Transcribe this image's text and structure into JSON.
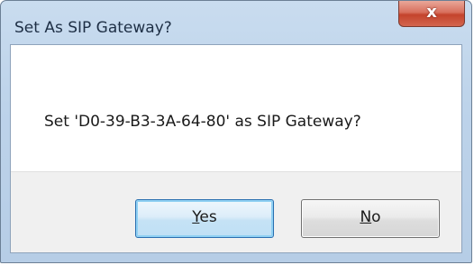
{
  "dialog": {
    "title": "Set As SIP Gateway?",
    "close_glyph": "x",
    "message": "Set 'D0-39-B3-3A-64-80' as SIP Gateway?",
    "buttons": {
      "yes": {
        "accesskey": "Y",
        "rest": "es"
      },
      "no": {
        "accesskey": "N",
        "rest": "o"
      }
    },
    "default_button": "yes"
  },
  "icons": {
    "close": "close-icon"
  },
  "colors": {
    "close_button": "#c4432c",
    "default_button_border": "#2a6fb0",
    "button_area_bg": "#f0f0f0"
  }
}
